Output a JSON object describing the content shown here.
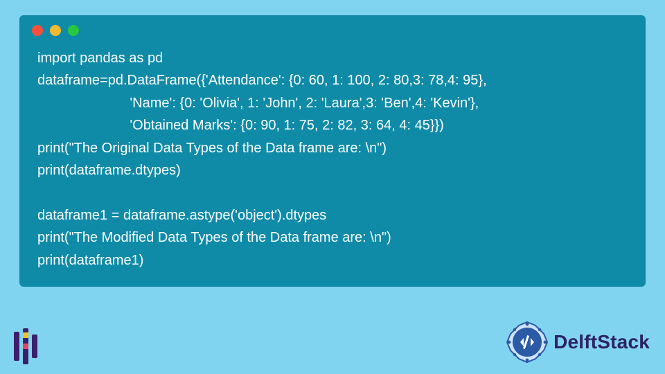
{
  "code_window": {
    "traffic_lights": [
      "red",
      "yellow",
      "green"
    ],
    "lines": [
      "import pandas as pd",
      "dataframe=pd.DataFrame({'Attendance': {0: 60, 1: 100, 2: 80,3: 78,4: 95},",
      "                        'Name': {0: 'Olivia', 1: 'John', 2: 'Laura',3: 'Ben',4: 'Kevin'},",
      "                        'Obtained Marks': {0: 90, 1: 75, 2: 82, 3: 64, 4: 45}})",
      "print(\"The Original Data Types of the Data frame are: \\n\")",
      "print(dataframe.dtypes)",
      "",
      "dataframe1 = dataframe.astype('object').dtypes",
      "print(\"The Modified Data Types of the Data frame are: \\n\")",
      "print(dataframe1)"
    ]
  },
  "brand": {
    "name": "DelftStack",
    "icon": "delftstack-badge"
  },
  "colors": {
    "page_bg": "#81d4f0",
    "window_bg": "#0f8ba8",
    "code_text": "#ffffff",
    "brand_text": "#2d2265"
  }
}
